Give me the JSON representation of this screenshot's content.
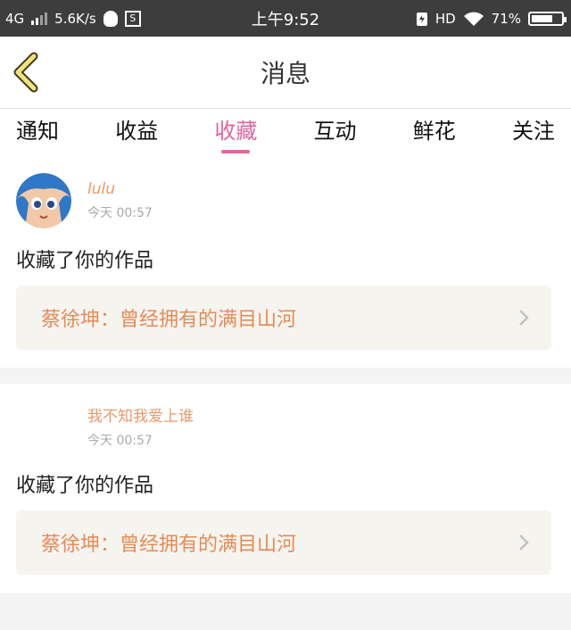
{
  "status_bar": {
    "network": "4G",
    "speed": "5.6K/s",
    "time": "上午9:52",
    "hd": "HD",
    "battery": "71%",
    "battery_level": 0.71
  },
  "header": {
    "title": "消息"
  },
  "tabs": [
    {
      "label": "通知",
      "active": false
    },
    {
      "label": "收益",
      "active": false
    },
    {
      "label": "收藏",
      "active": true
    },
    {
      "label": "互动",
      "active": false
    },
    {
      "label": "鲜花",
      "active": false
    },
    {
      "label": "关注",
      "active": false
    }
  ],
  "messages": [
    {
      "username": "lulu",
      "time": "今天 00:57",
      "action": "收藏了你的作品",
      "work": "蔡徐坤：曾经拥有的满目山河"
    },
    {
      "username": "我不知我爱上谁",
      "time": "今天 00:57",
      "action": "收藏了你的作品",
      "work": "蔡徐坤：曾经拥有的满目山河"
    }
  ],
  "colors": {
    "accent": "#e2669b",
    "username": "#e89a6a",
    "work_text": "#e48b57"
  }
}
